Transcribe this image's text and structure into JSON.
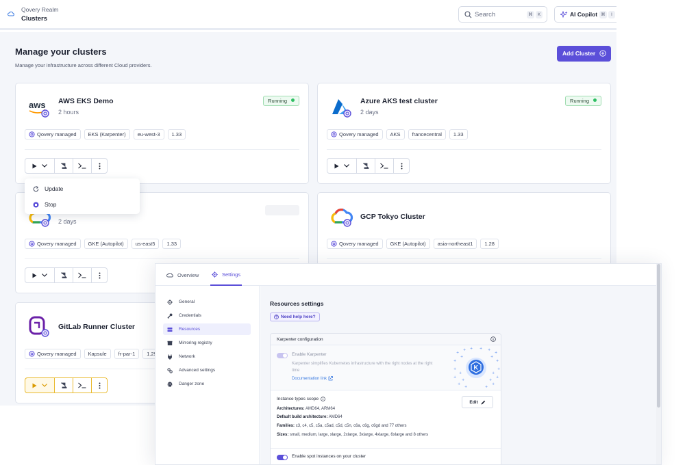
{
  "topbar": {
    "realm": "Qovery Realm",
    "title": "Clusters",
    "search_label": "Search",
    "search_keys": [
      "⌘",
      "K"
    ],
    "copilot_label": "AI Copilot",
    "copilot_keys": [
      "⌘",
      "I"
    ]
  },
  "page": {
    "title": "Manage your clusters",
    "subtitle": "Manage your infrastructure across different Cloud providers.",
    "add_button": "Add Cluster"
  },
  "colors": {
    "accent": "#5b4fd9",
    "running": "#2fbf63"
  },
  "clusters": [
    {
      "name": "AWS EKS Demo",
      "age": "2 hours",
      "status": "Running",
      "logo": "aws-logo",
      "tags": [
        "Qovery managed",
        "EKS (Karpenter)",
        "eu-west-3",
        "1.33"
      ]
    },
    {
      "name": "Azure AKS test cluster",
      "age": "2 days",
      "status": "Running",
      "logo": "azure-logo",
      "tags": [
        "Qovery managed",
        "AKS",
        "francecentral",
        "1.33"
      ]
    },
    {
      "name": "",
      "age": "2 days",
      "status": "",
      "logo": "gcp-logo",
      "tags": [
        "Qovery managed",
        "GKE (Autopilot)",
        "us-east5",
        "1.33"
      ]
    },
    {
      "name": "GCP Tokyo Cluster",
      "age": "",
      "status": "",
      "logo": "gcp-logo",
      "tags": [
        "Qovery managed",
        "GKE (Autopilot)",
        "asia-northeast1",
        "1.28"
      ]
    },
    {
      "name": "GitLab Runner Cluster",
      "age": "",
      "status": "",
      "logo": "qovery-logo",
      "tags": [
        "Qovery managed",
        "Kapsule",
        "fr-par-1",
        "1.29"
      ]
    }
  ],
  "dropdown": {
    "items": [
      "Update",
      "Stop"
    ]
  },
  "settings": {
    "tabs": [
      "Overview",
      "Settings"
    ],
    "active_tab": "Settings",
    "sidebar": [
      "General",
      "Credentials",
      "Resources",
      "Mirroring registry",
      "Network",
      "Advanced settings",
      "Danger zone"
    ],
    "active_sidebar": "Resources",
    "resources_title": "Resources settings",
    "help_button": "Need help here?",
    "karpenter": {
      "header": "Karpenter configuration",
      "enable_label": "Enable Karpenter",
      "enable_desc": "Karpenter simplifies Kubernetes infrastructure with the right nodes at the right time",
      "doc_link": "Documentation link",
      "scope_title": "Instance types scope",
      "edit_button": "Edit",
      "architectures_label": "Architectures:",
      "architectures_value": "AMD64, ARM64",
      "default_build_label": "Default build architecture:",
      "default_build_value": "AMD64",
      "families_label": "Families:",
      "families_value": "c3, c4, c5, c5a, c5ad, c5d, c5n, c6a, c6g, c6gd and 77 others",
      "sizes_label": "Sizes:",
      "sizes_value": "small, medium, large, xlarge, 2xlarge, 3xlarge, 4xlarge, 6xlarge and 8 others",
      "spot_label": "Enable spot instances on your cluster",
      "spot_enabled": true
    }
  }
}
